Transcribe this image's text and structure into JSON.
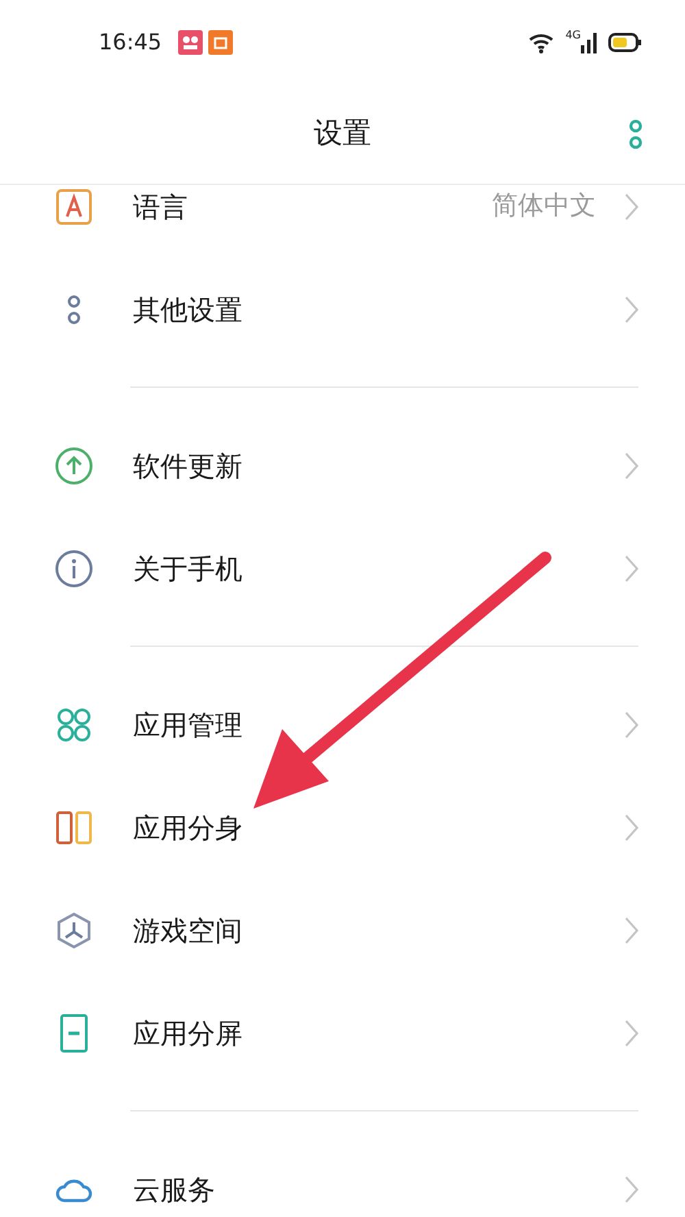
{
  "status_bar": {
    "time": "16:45",
    "network": "4G"
  },
  "header": {
    "title": "设置"
  },
  "sections": [
    {
      "items": [
        {
          "kind": "language",
          "label": "语言",
          "value": "简体中文"
        },
        {
          "kind": "more",
          "label": "其他设置"
        }
      ]
    },
    {
      "items": [
        {
          "kind": "update",
          "label": "软件更新"
        },
        {
          "kind": "info",
          "label": "关于手机"
        }
      ]
    },
    {
      "items": [
        {
          "kind": "apps",
          "label": "应用管理"
        },
        {
          "kind": "clone",
          "label": "应用分身"
        },
        {
          "kind": "game",
          "label": "游戏空间"
        },
        {
          "kind": "split",
          "label": "应用分屏"
        }
      ]
    },
    {
      "items": [
        {
          "kind": "cloud",
          "label": "云服务"
        }
      ]
    }
  ]
}
